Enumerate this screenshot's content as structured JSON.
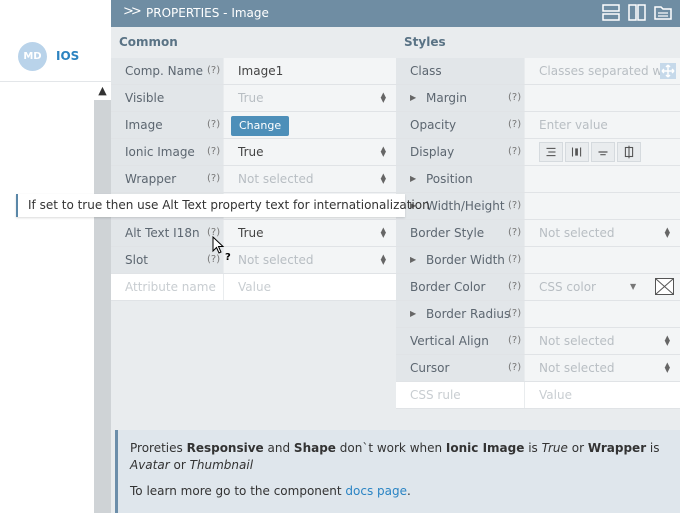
{
  "mode": {
    "badge": "MD",
    "label": "IOS"
  },
  "header": {
    "chevron": ">>",
    "title": "PROPERTIES - Image"
  },
  "common": {
    "title": "Common",
    "rows": [
      {
        "label": "Comp. Name",
        "help": "(?)",
        "value": "Image1"
      },
      {
        "label": "Visible",
        "help": "",
        "value": "True"
      },
      {
        "label": "Image",
        "help": "(?)",
        "button": "Change"
      },
      {
        "label": "Ionic Image",
        "help": "(?)",
        "value": "True"
      },
      {
        "label": "Wrapper",
        "help": "(?)",
        "value": "Not selected"
      },
      {
        "label": "",
        "help": "",
        "value": ""
      },
      {
        "label": "Alt Text I18n",
        "help": "(?)",
        "value": "True"
      },
      {
        "label": "Slot",
        "help": "(?)",
        "value": "Not selected"
      }
    ],
    "attr_placeholder": "Attribute name",
    "value_placeholder": "Value"
  },
  "styles": {
    "title": "Styles",
    "class_label": "Class",
    "class_placeholder": "Classes separated w",
    "margin": "Margin",
    "opacity": "Opacity",
    "opacity_placeholder": "Enter value",
    "display": "Display",
    "position": "Position",
    "width_height": "Width/Height",
    "border_style": "Border Style",
    "border_style_value": "Not selected",
    "border_width": "Border Width",
    "border_color": "Border Color",
    "border_color_placeholder": "CSS color",
    "border_radius": "Border Radius",
    "vertical_align": "Vertical Align",
    "vertical_align_value": "Not selected",
    "cursor": "Cursor",
    "cursor_value": "Not selected",
    "css_rule_placeholder": "CSS rule",
    "css_value_placeholder": "Value",
    "help": "(?)"
  },
  "tooltip": "If set to true then use Alt Text property text for internationalization",
  "note": {
    "t1": "Proreties ",
    "b1": "Responsive",
    "t2": " and ",
    "b2": "Shape",
    "t3": " don`t work when ",
    "b3": "Ionic Image",
    "t4": " is ",
    "i1": "True",
    "t5": " or ",
    "b4": "Wrapper",
    "t6": " is ",
    "i2": "Avatar",
    "t7": " or ",
    "i3": "Thumbnail",
    "l2_text": "To learn more go to the component ",
    "l2_link": "docs page",
    "l2_end": "."
  },
  "icons": [
    "layout-rows-icon",
    "layout-columns-icon",
    "folder-icon",
    "move-icon",
    "no-color-icon",
    "cursor-help-icon"
  ]
}
